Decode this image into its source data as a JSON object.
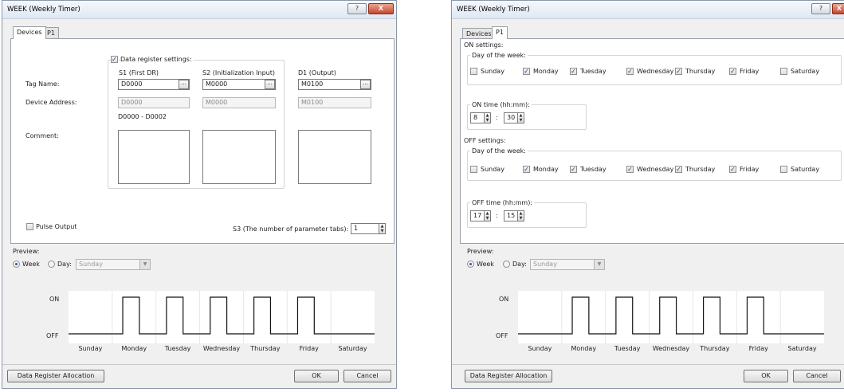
{
  "left_window": {
    "title": "WEEK (Weekly Timer)",
    "title_buttons": {
      "help": "?",
      "close": "X"
    },
    "tabs": [
      "Devices",
      "P1"
    ],
    "data_register_settings": {
      "label": "Data register settings:",
      "checked": true
    },
    "row_labels": {
      "tag_name": "Tag Name:",
      "device_address": "Device Address:",
      "comment": "Comment:"
    },
    "columns": [
      {
        "header": "S1 (First DR)",
        "tag": "D0000",
        "address": "D0000"
      },
      {
        "header": "S2 (Initialization Input)",
        "tag": "M0000",
        "address": "M0000"
      },
      {
        "header": "D1 (Output)",
        "tag": "M0100",
        "address": "M0100"
      }
    ],
    "browse_label": "...",
    "range_text": "D0000 - D0002",
    "pulse_output": {
      "label": "Pulse Output",
      "checked": false
    },
    "s3": {
      "label": "S3 (The number of parameter tabs):",
      "value": "1"
    },
    "preview": {
      "label": "Preview:",
      "week_label": "Week",
      "day_label": "Day:",
      "day_value": "Sunday",
      "on_label": "ON",
      "off_label": "OFF",
      "days": [
        "Sunday",
        "Monday",
        "Tuesday",
        "Wednesday",
        "Thursday",
        "Friday",
        "Saturday"
      ]
    },
    "buttons": {
      "allocation": "Data Register Allocation",
      "ok": "OK",
      "cancel": "Cancel"
    }
  },
  "right_window": {
    "title": "WEEK (Weekly Timer)",
    "title_buttons": {
      "help": "?",
      "close": "X"
    },
    "tabs": [
      "Devices",
      "P1"
    ],
    "on_settings": {
      "label": "ON settings:",
      "day_group_label": "Day of the week:",
      "days": [
        {
          "label": "Sunday",
          "checked": false
        },
        {
          "label": "Monday",
          "checked": true
        },
        {
          "label": "Tuesday",
          "checked": true
        },
        {
          "label": "Wednesday",
          "checked": true
        },
        {
          "label": "Thursday",
          "checked": true
        },
        {
          "label": "Friday",
          "checked": true
        },
        {
          "label": "Saturday",
          "checked": false
        }
      ],
      "time_label": "ON time (hh:mm):",
      "hour": "8",
      "minute": "30"
    },
    "off_settings": {
      "label": "OFF settings:",
      "day_group_label": "Day of the week:",
      "days": [
        {
          "label": "Sunday",
          "checked": false
        },
        {
          "label": "Monday",
          "checked": true
        },
        {
          "label": "Tuesday",
          "checked": true
        },
        {
          "label": "Wednesday",
          "checked": true
        },
        {
          "label": "Thursday",
          "checked": true
        },
        {
          "label": "Friday",
          "checked": true
        },
        {
          "label": "Saturday",
          "checked": false
        }
      ],
      "time_label": "OFF time (hh:mm):",
      "hour": "17",
      "minute": "15"
    },
    "time_separator": ":",
    "preview": {
      "label": "Preview:",
      "week_label": "Week",
      "day_label": "Day:",
      "day_value": "Sunday",
      "on_label": "ON",
      "off_label": "OFF",
      "days": [
        "Sunday",
        "Monday",
        "Tuesday",
        "Wednesday",
        "Thursday",
        "Friday",
        "Saturday"
      ]
    },
    "buttons": {
      "allocation": "Data Register Allocation",
      "ok": "OK",
      "cancel": "Cancel"
    }
  }
}
